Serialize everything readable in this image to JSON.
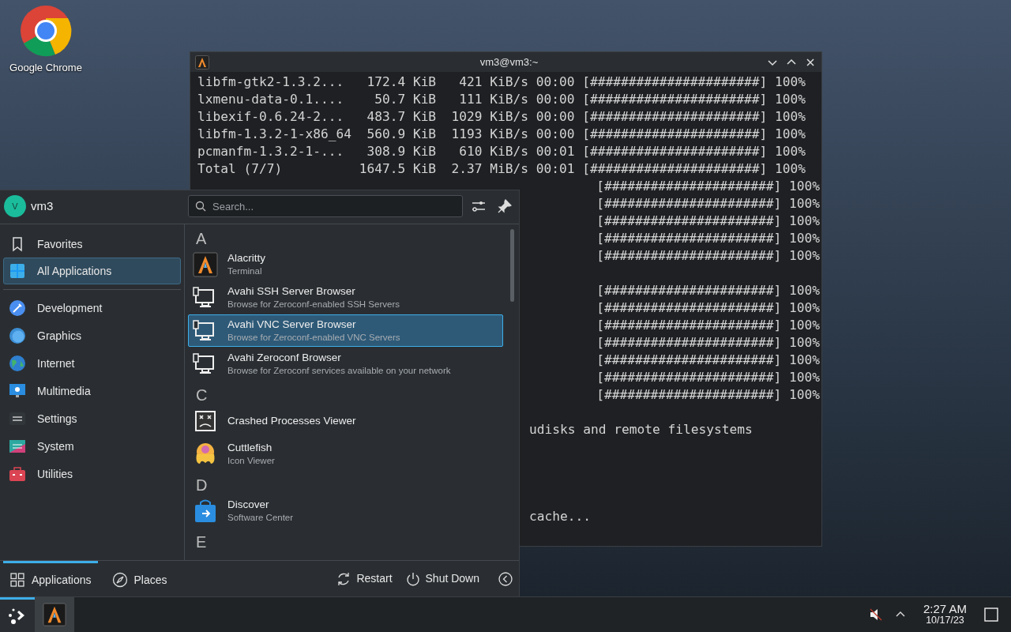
{
  "desktop_icons": [
    {
      "label": "Google Chrome"
    }
  ],
  "terminal": {
    "title": "vm3@vm3:~",
    "lines": [
      {
        "kind": "full",
        "text": "libfm-gtk2-1.3.2...   172.4 KiB   421 KiB/s 00:00 [######################] 100%"
      },
      {
        "kind": "full",
        "text": "lxmenu-data-0.1....    50.7 KiB   111 KiB/s 00:00 [######################] 100%"
      },
      {
        "kind": "full",
        "text": "libexif-0.6.24-2...   483.7 KiB  1029 KiB/s 00:00 [######################] 100%"
      },
      {
        "kind": "full",
        "text": "libfm-1.3.2-1-x86_64  560.9 KiB  1193 KiB/s 00:00 [######################] 100%"
      },
      {
        "kind": "full",
        "text": "pcmanfm-1.3.2-1-...   308.9 KiB   610 KiB/s 00:01 [######################] 100%"
      },
      {
        "kind": "full",
        "text": "Total (7/7)          1647.5 KiB  2.37 MiB/s 00:01 [######################] 100%"
      },
      {
        "kind": "right",
        "text": "[######################] 100%"
      },
      {
        "kind": "right",
        "text": "[######################] 100%"
      },
      {
        "kind": "right",
        "text": "[######################] 100%"
      },
      {
        "kind": "right",
        "text": "[######################] 100%"
      },
      {
        "kind": "right",
        "text": "[######################] 100%"
      },
      {
        "kind": "blank"
      },
      {
        "kind": "right",
        "text": "[######################] 100%"
      },
      {
        "kind": "right",
        "text": "[######################] 100%"
      },
      {
        "kind": "right",
        "text": "[######################] 100%"
      },
      {
        "kind": "right",
        "text": "[######################] 100%"
      },
      {
        "kind": "right",
        "text": "[######################] 100%"
      },
      {
        "kind": "right",
        "text": "[######################] 100%"
      },
      {
        "kind": "right",
        "text": "[######################] 100%"
      },
      {
        "kind": "blank"
      },
      {
        "kind": "tail",
        "text": "udisks and remote filesystems"
      },
      {
        "kind": "blank"
      },
      {
        "kind": "blank"
      },
      {
        "kind": "blank"
      },
      {
        "kind": "blank"
      },
      {
        "kind": "tail",
        "text": "cache..."
      }
    ]
  },
  "menu": {
    "user": {
      "initial": "V",
      "name": "vm3"
    },
    "search": {
      "placeholder": "Search..."
    },
    "sidebar": {
      "items": [
        {
          "label": "Favorites",
          "selected": false
        },
        {
          "label": "All Applications",
          "selected": true
        }
      ],
      "categories": [
        {
          "label": "Development",
          "selected": false
        },
        {
          "label": "Graphics",
          "selected": false
        },
        {
          "label": "Internet",
          "selected": false
        },
        {
          "label": "Multimedia",
          "selected": false
        },
        {
          "label": "Settings",
          "selected": false
        },
        {
          "label": "System",
          "selected": false
        },
        {
          "label": "Utilities",
          "selected": false
        }
      ]
    },
    "sections": [
      {
        "letter": "A",
        "apps": [
          {
            "name": "Alacritty",
            "description": "Terminal",
            "selected": false
          },
          {
            "name": "Avahi SSH Server Browser",
            "description": "Browse for Zeroconf-enabled SSH Servers",
            "selected": false
          },
          {
            "name": "Avahi VNC Server Browser",
            "description": "Browse for Zeroconf-enabled VNC Servers",
            "selected": true
          },
          {
            "name": "Avahi Zeroconf Browser",
            "description": "Browse for Zeroconf services available on your network",
            "selected": false
          }
        ]
      },
      {
        "letter": "C",
        "apps": [
          {
            "name": "Crashed Processes Viewer",
            "selected": false
          },
          {
            "name": "Cuttlefish",
            "description": "Icon Viewer",
            "selected": false
          }
        ]
      },
      {
        "letter": "D",
        "apps": [
          {
            "name": "Discover",
            "description": "Software Center",
            "selected": false
          }
        ]
      },
      {
        "letter": "E"
      }
    ],
    "footer_tabs": [
      {
        "label": "Applications",
        "selected": true
      },
      {
        "label": "Places",
        "selected": false
      }
    ],
    "power_buttons": [
      {
        "label": "Restart"
      },
      {
        "label": "Shut Down"
      }
    ]
  },
  "taskbar": {
    "launcher_active": true,
    "clock": {
      "time": "2:27 AM",
      "date": "10/17/23"
    }
  }
}
